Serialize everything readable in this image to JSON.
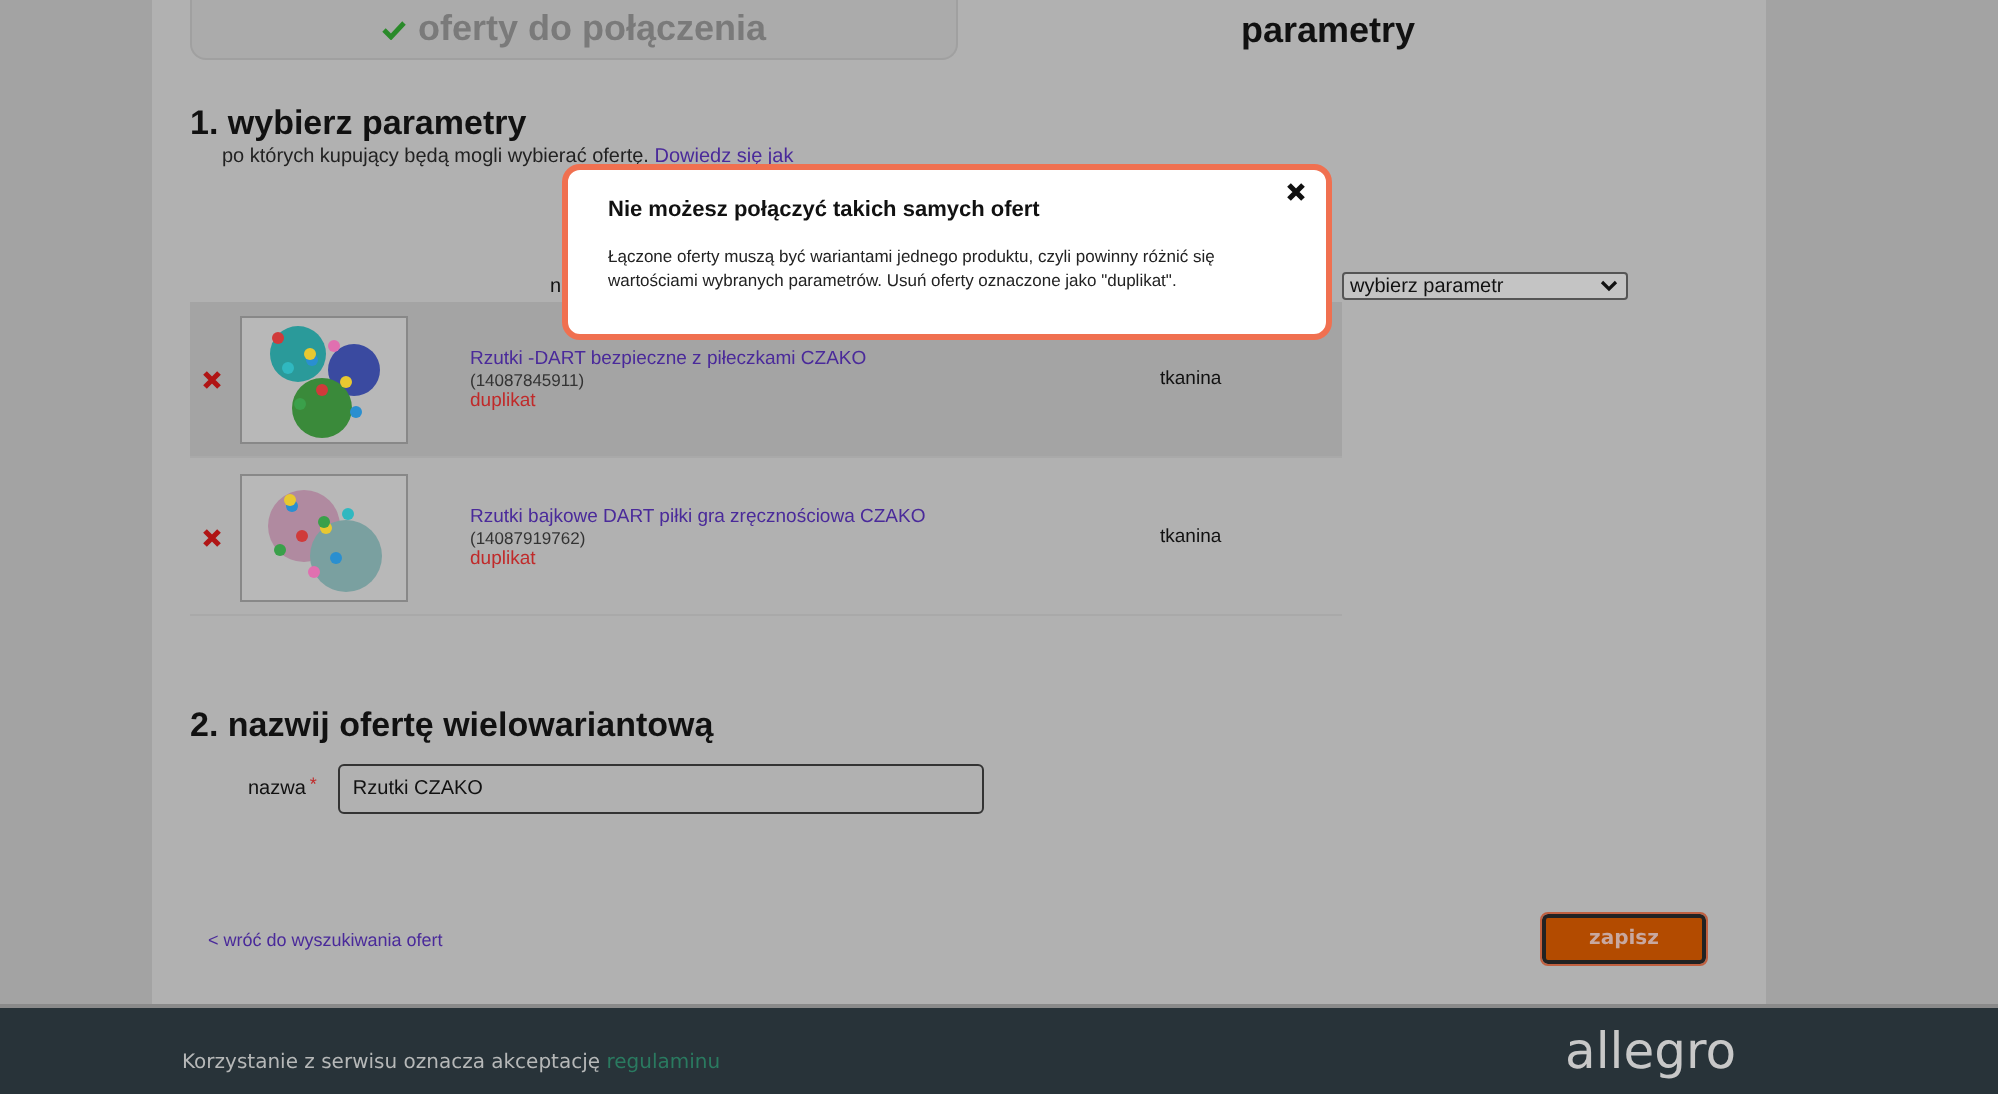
{
  "tabs": [
    {
      "label": "oferty do połączenia",
      "selected": false,
      "done": true
    },
    {
      "label": "parametry",
      "selected": true,
      "done": false
    }
  ],
  "section_1": {
    "heading": "1. wybierz parametry",
    "hint": "po których kupujący będą mogli wybierać ofertę.",
    "hint_link": "Dowiedz się jak",
    "column_label": "n",
    "parameter_select": {
      "value": "wybierz parametr"
    }
  },
  "offers": [
    {
      "title": "Rzutki -DART bezpieczne z piłeczkami CZAKO",
      "id": "(14087845911)",
      "status": "duplikat",
      "value": "tkanina",
      "selected": true
    },
    {
      "title": "Rzutki bajkowe DART piłki gra zręcznościowa CZAKO",
      "id": "(14087919762)",
      "status": "duplikat",
      "value": "tkanina",
      "selected": false
    }
  ],
  "section_2": {
    "heading": "2. nazwij ofertę wielowariantową",
    "field_label": "nazwa",
    "required_mark": "*",
    "value": "Rzutki CZAKO"
  },
  "back_link": "< wróć do wyszukiwania ofert",
  "save_button": "zapisz",
  "dialog": {
    "title": "Nie możesz połączyć takich samych ofert",
    "message": "Łączone oferty muszą być wariantami jednego produktu, czyli powinny różnić się wartościami wybranych parametrów. Usuń oferty oznaczone jako \"duplikat\"."
  },
  "footer": {
    "text": "Korzystanie z serwisu oznacza akceptację",
    "link": "regulaminu",
    "logo": "allegro"
  }
}
